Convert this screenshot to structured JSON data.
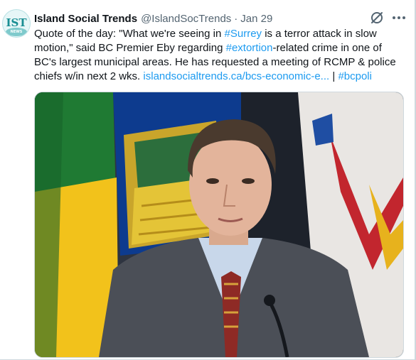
{
  "author": {
    "display_name": "Island Social Trends",
    "handle": "@IslandSocTrends",
    "separator": "·",
    "date": "Jan 29",
    "avatar_text": "IST",
    "avatar_subtext": "NEWS"
  },
  "tweet": {
    "p1": "Quote of the day: \"What we're seeing in ",
    "tag_surrey": "#Surrey",
    "p2": " is a terror attack in slow motion,\" said BC Premier Eby regarding ",
    "tag_extortion": "#extortion",
    "p3": "-related crime in one of BC's largest municipal areas. He has requested a meeting of RCMP & police chiefs w/in next 2 wks. ",
    "link_url": "islandsocialtrends.ca/bcs-economic-e...",
    "p4": " | ",
    "tag_bcpoli": "#bcpoli"
  },
  "icons": {
    "grok": "grok-slash-circle-icon",
    "more": "more-horizontal-icon"
  },
  "media": {
    "description_hidden": true
  },
  "colors": {
    "link": "#1d9bf0",
    "text": "#0f1419",
    "muted": "#536471"
  }
}
